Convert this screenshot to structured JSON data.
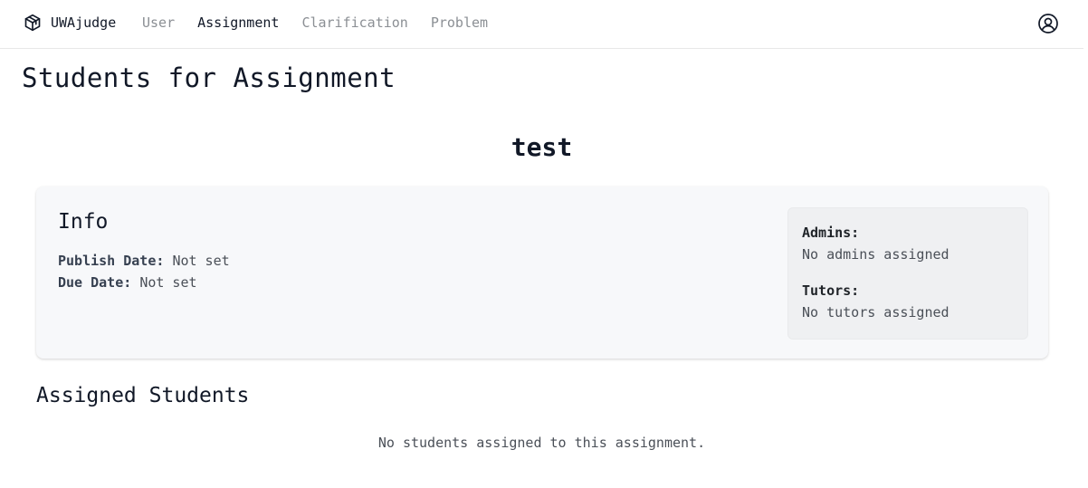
{
  "nav": {
    "brand": "UWAjudge",
    "brand_icon": "cube-icon",
    "links": [
      "User",
      "Assignment",
      "Clarification",
      "Problem"
    ],
    "active": "Assignment",
    "profile_icon": "user-circle-icon"
  },
  "page": {
    "title": "Students for Assignment",
    "assignment_name": "test"
  },
  "info": {
    "heading": "Info",
    "publish_label": "Publish Date:",
    "publish_value": "Not set",
    "due_label": "Due Date:",
    "due_value": "Not set"
  },
  "staff": {
    "admins_label": "Admins:",
    "admins_value": "No admins assigned",
    "tutors_label": "Tutors:",
    "tutors_value": "No tutors assigned"
  },
  "students": {
    "heading": "Assigned Students",
    "empty_message": "No students assigned to this assignment."
  },
  "colors": {
    "text": "#111827",
    "muted": "#8b8f94",
    "card_bg": "#f7f8fa",
    "staff_bg": "#eff0f2"
  }
}
